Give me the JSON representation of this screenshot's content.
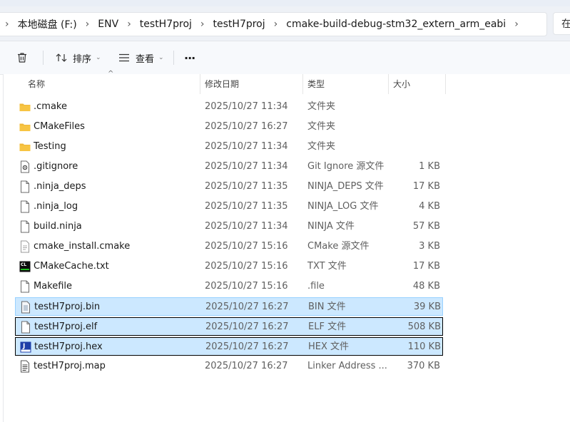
{
  "breadcrumb": [
    "本地磁盘 (F:)",
    "ENV",
    "testH7proj",
    "testH7proj",
    "cmake-build-debug-stm32_extern_arm_eabi"
  ],
  "search_stub": "在",
  "toolbar": {
    "sort_label": "排序",
    "view_label": "查看",
    "more_label": "···"
  },
  "columns": {
    "name": "名称",
    "date": "修改日期",
    "type": "类型",
    "size": "大小"
  },
  "files": [
    {
      "name": ".cmake",
      "date": "2025/10/27 11:34",
      "type": "文件夹",
      "size": "",
      "icon": "folder-icon",
      "selected": false
    },
    {
      "name": "CMakeFiles",
      "date": "2025/10/27 16:27",
      "type": "文件夹",
      "size": "",
      "icon": "folder-icon",
      "selected": false
    },
    {
      "name": "Testing",
      "date": "2025/10/27 11:34",
      "type": "文件夹",
      "size": "",
      "icon": "folder-icon",
      "selected": false
    },
    {
      "name": ".gitignore",
      "date": "2025/10/27 11:34",
      "type": "Git Ignore 源文件",
      "size": "1 KB",
      "icon": "gear-file-icon",
      "selected": false
    },
    {
      "name": ".ninja_deps",
      "date": "2025/10/27 11:35",
      "type": "NINJA_DEPS 文件",
      "size": "17 KB",
      "icon": "file-icon",
      "selected": false
    },
    {
      "name": ".ninja_log",
      "date": "2025/10/27 11:35",
      "type": "NINJA_LOG 文件",
      "size": "4 KB",
      "icon": "file-icon",
      "selected": false
    },
    {
      "name": "build.ninja",
      "date": "2025/10/27 11:34",
      "type": "NINJA 文件",
      "size": "57 KB",
      "icon": "file-icon",
      "selected": false
    },
    {
      "name": "cmake_install.cmake",
      "date": "2025/10/27 15:16",
      "type": "CMake 源文件",
      "size": "3 KB",
      "icon": "text-file-icon",
      "selected": false
    },
    {
      "name": "CMakeCache.txt",
      "date": "2025/10/27 15:16",
      "type": "TXT 文件",
      "size": "17 KB",
      "icon": "cl-app-icon",
      "selected": false
    },
    {
      "name": "Makefile",
      "date": "2025/10/27 15:16",
      "type": ".file",
      "size": "48 KB",
      "icon": "file-icon",
      "selected": false
    },
    {
      "name": "testH7proj.bin",
      "date": "2025/10/27 16:27",
      "type": "BIN 文件",
      "size": "39 KB",
      "icon": "bin-file-icon",
      "selected": true,
      "focus": false
    },
    {
      "name": "testH7proj.elf",
      "date": "2025/10/27 16:27",
      "type": "ELF 文件",
      "size": "508 KB",
      "icon": "file-icon",
      "selected": true,
      "focus": true
    },
    {
      "name": "testH7proj.hex",
      "date": "2025/10/27 16:27",
      "type": "HEX 文件",
      "size": "110 KB",
      "icon": "j-flash-icon",
      "selected": true,
      "focus": true
    },
    {
      "name": "testH7proj.map",
      "date": "2025/10/27 16:27",
      "type": "Linker Address ...",
      "size": "370 KB",
      "icon": "map-file-icon",
      "selected": false
    }
  ],
  "colors": {
    "selection": "#cce8ff",
    "selection_border": "#99d1ff",
    "folder": "#f7c443"
  },
  "icon_labels": {
    "cl": "CL",
    "j": "J"
  }
}
